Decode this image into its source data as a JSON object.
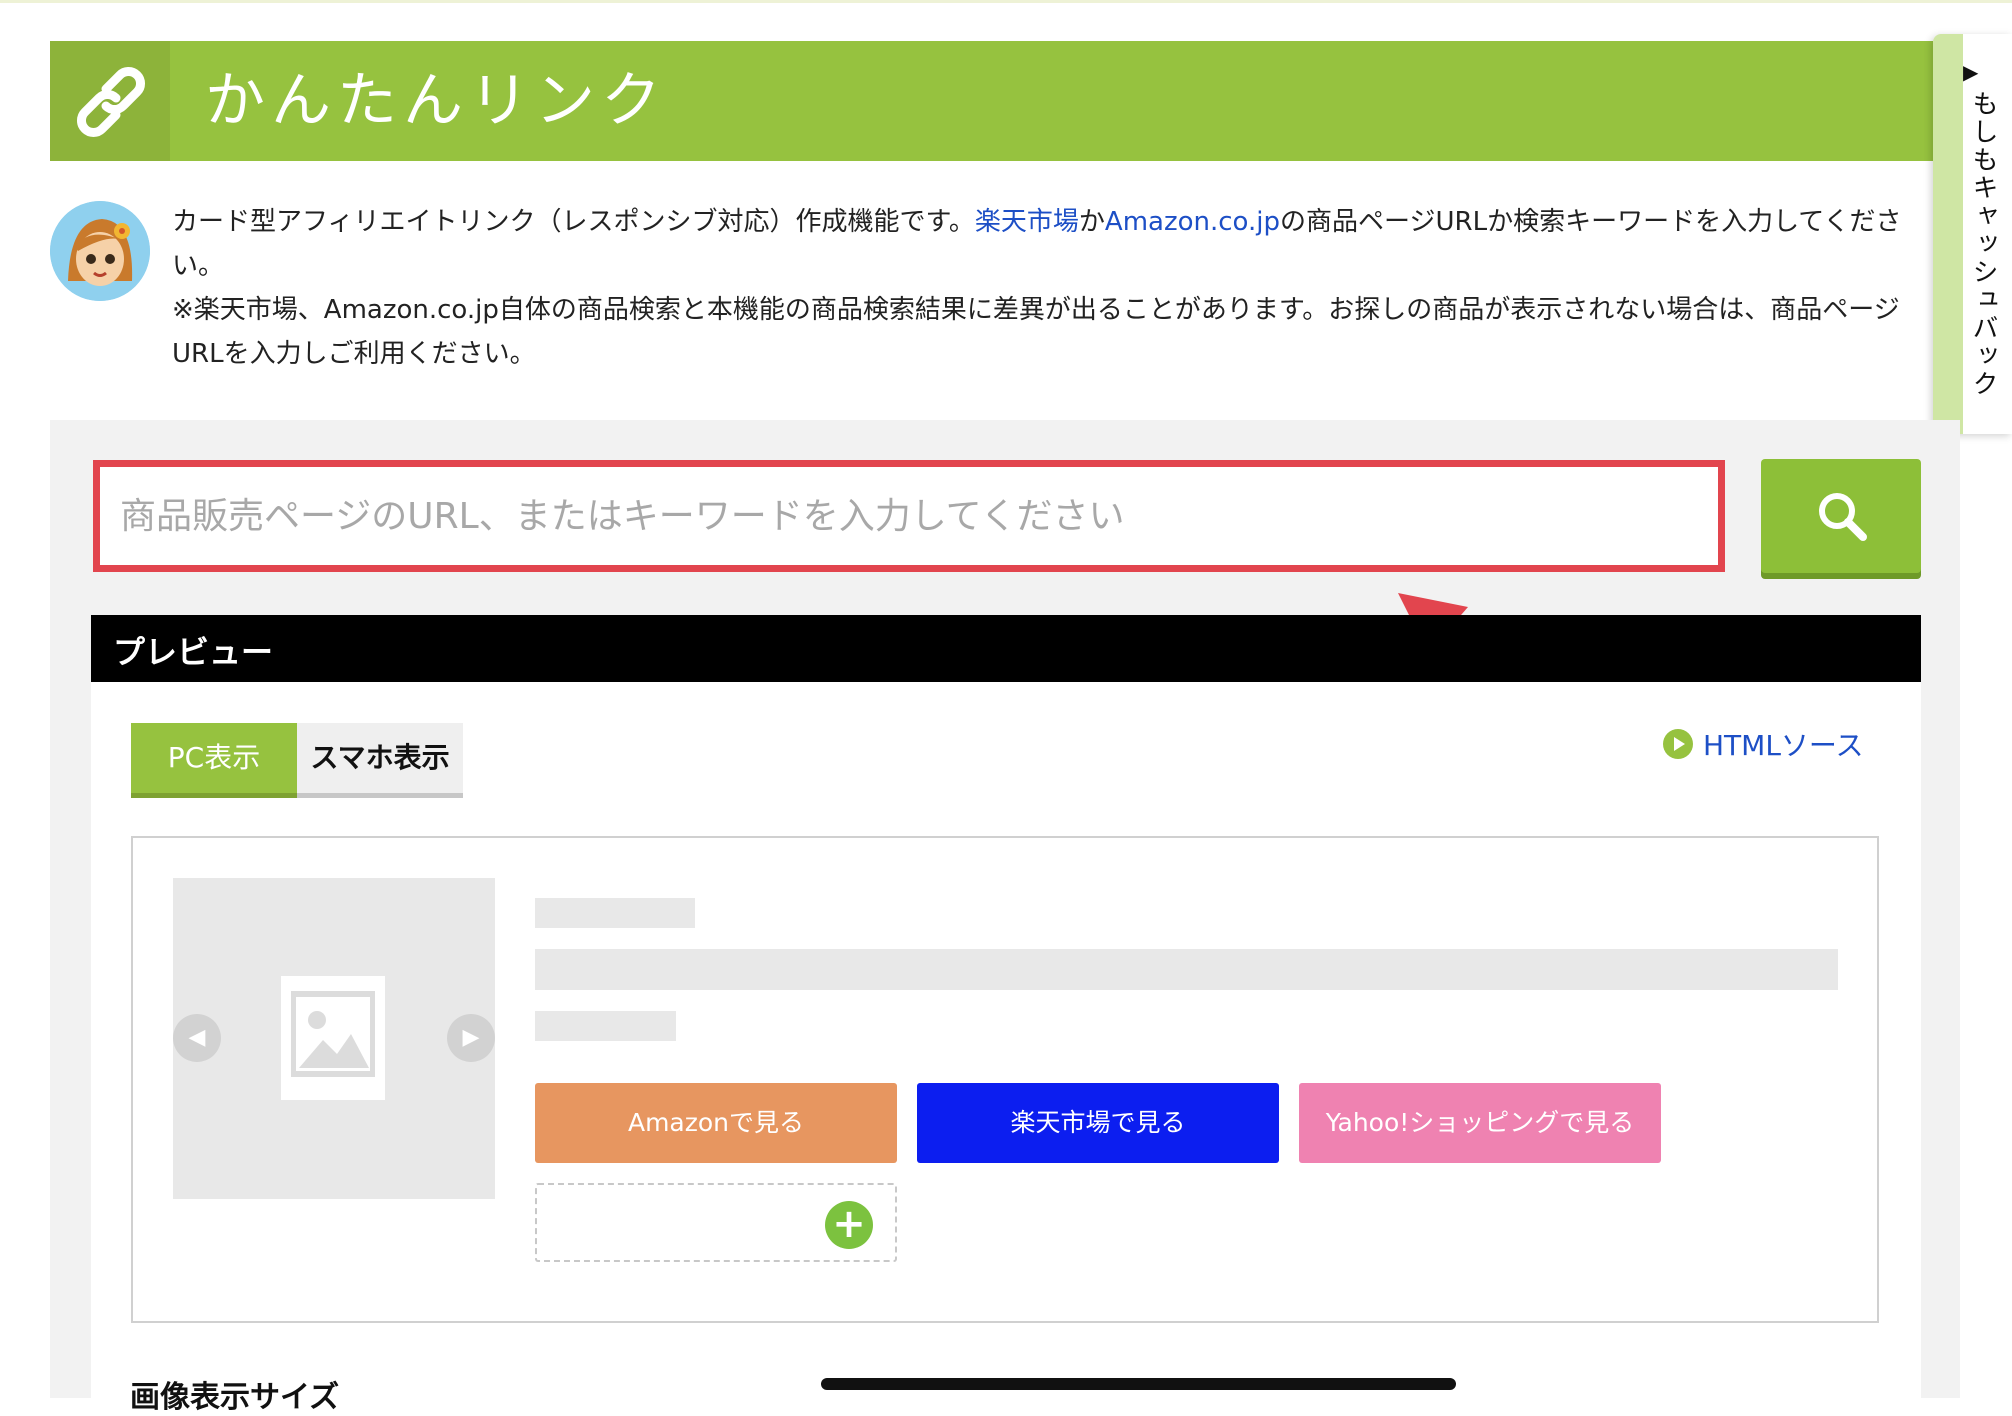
{
  "header": {
    "title": "かんたんリンク",
    "icon": "link-chain-icon",
    "color": "#96c23f"
  },
  "intro": {
    "line1_pre": "カード型アフィリエイトリンク（レスポンシブ対応）作成機能です。",
    "rakuten_link": "楽天市場",
    "line1_mid": "か",
    "amazon_link": "Amazon.co.jp",
    "line1_post": "の商品ページURLか検索キーワードを入力してください。",
    "note": "※楽天市場、Amazon.co.jp自体の商品検索と本機能の商品検索結果に差異が出ることがあります。お探しの商品が表示されない場合は、商品ページURLを入力しご利用ください。"
  },
  "side_tab": {
    "arrow": "▶",
    "label": "もしもキャッシュバック"
  },
  "search": {
    "placeholder": "商品販売ページのURL、またはキーワードを入力してください",
    "value": "",
    "button_icon": "search-icon",
    "highlight_color": "#e2454e"
  },
  "preview": {
    "title": "プレビュー",
    "tabs": [
      {
        "label": "PC表示",
        "active": true
      },
      {
        "label": "スマホ表示",
        "active": false
      }
    ],
    "html_link": "HTMLソース",
    "buttons": [
      {
        "label": "Amazonで見る",
        "color": "#e79660"
      },
      {
        "label": "楽天市場で見る",
        "color": "#0c1ef0"
      },
      {
        "label": "Yahoo!ショッピングで見る",
        "color": "#ef82b1"
      }
    ],
    "add_icon": "plus-circle-icon"
  },
  "section": {
    "label": "画像表示サイズ"
  }
}
